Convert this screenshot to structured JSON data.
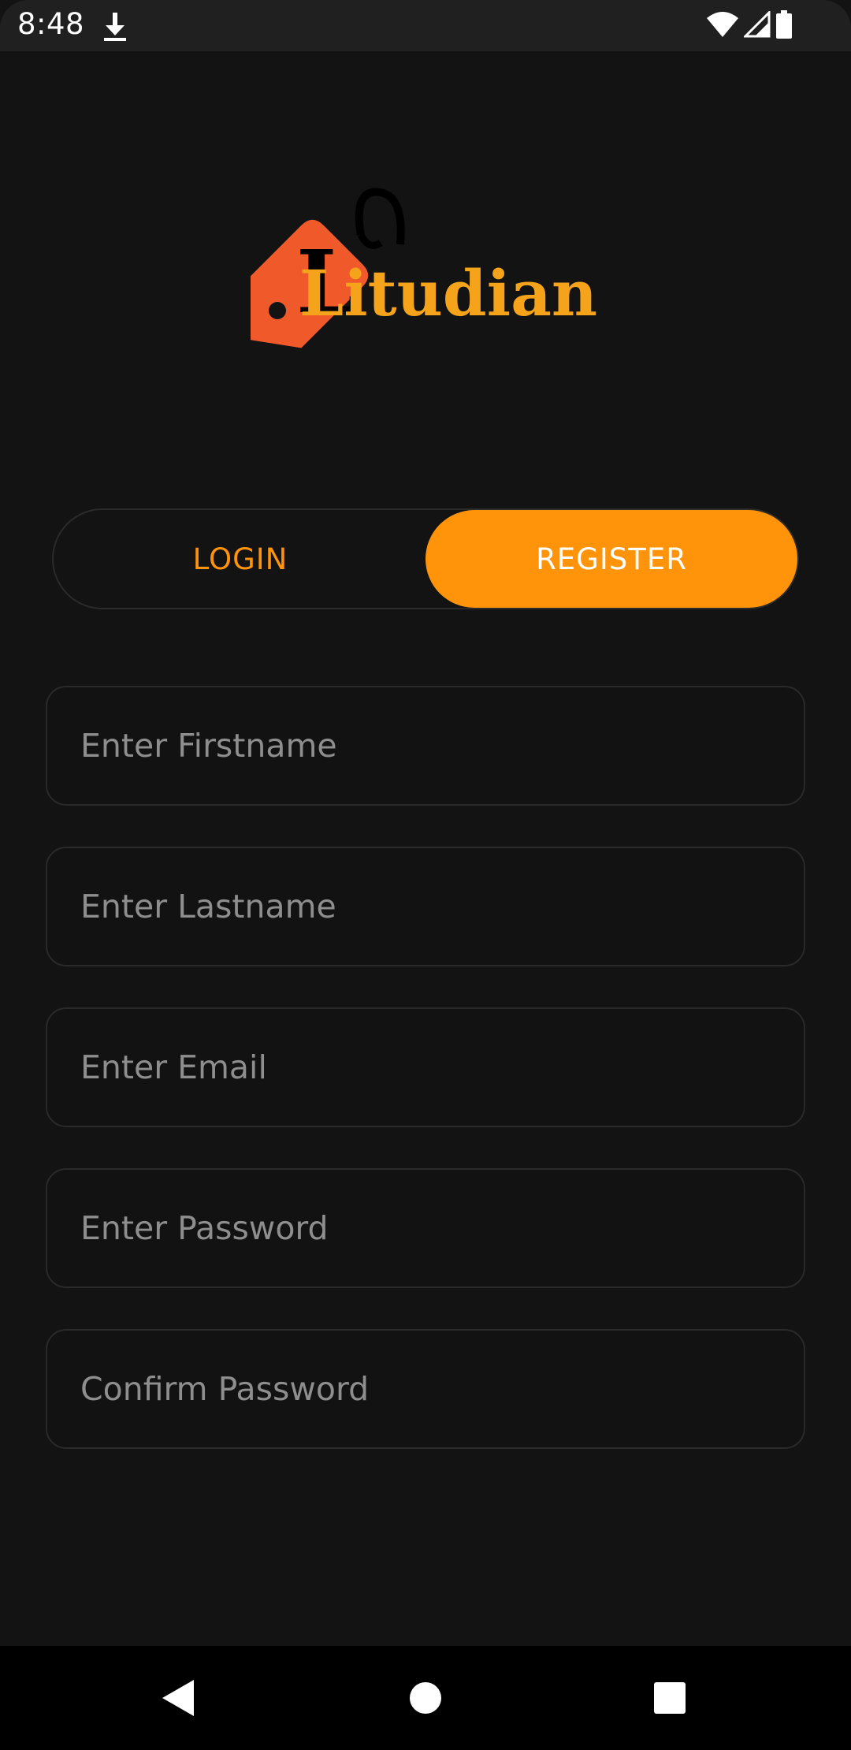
{
  "status_bar": {
    "time": "8:48",
    "icons": [
      "download-icon",
      "wifi-icon",
      "cell-signal-icon",
      "battery-icon"
    ]
  },
  "logo": {
    "text": "Litudian",
    "colors": {
      "tag": "#f05a2b",
      "text": "#f5a31a",
      "ink": "#000000"
    }
  },
  "auth_toggle": {
    "login_label": "LOGIN",
    "register_label": "REGISTER",
    "selected": "register"
  },
  "form": {
    "fields": [
      {
        "placeholder": "Enter Firstname",
        "value": ""
      },
      {
        "placeholder": "Enter Lastname",
        "value": ""
      },
      {
        "placeholder": "Enter Email",
        "value": ""
      },
      {
        "placeholder": "Enter Password",
        "value": ""
      },
      {
        "placeholder": "Confirm Password",
        "value": ""
      }
    ]
  },
  "nav_bar": {
    "icons": [
      "back-icon",
      "home-icon",
      "recents-icon"
    ]
  },
  "colors": {
    "background": "#131313",
    "accent": "#ff930a",
    "field_border": "#2a2a2a",
    "placeholder": "#8e8e8e"
  }
}
